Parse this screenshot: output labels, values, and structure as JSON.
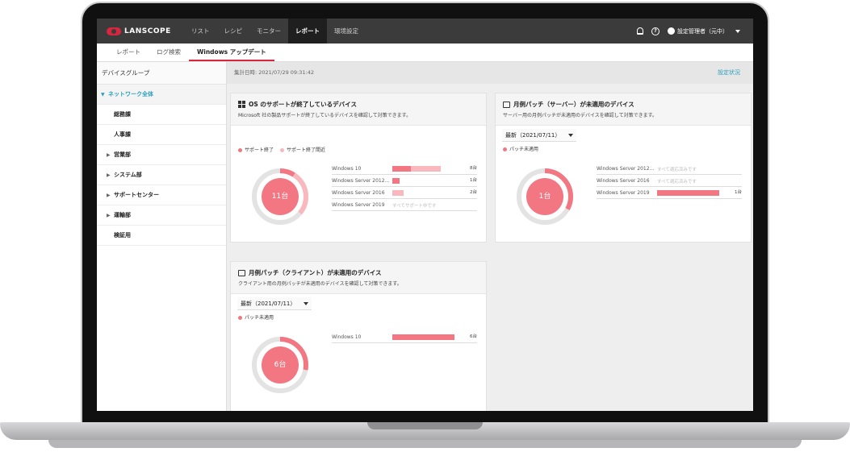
{
  "topbar": {
    "logo": "LANSCOPE",
    "nav": [
      "リスト",
      "レシピ",
      "モニター",
      "レポート",
      "環境設定"
    ],
    "active_nav": "レポート",
    "user_name": "設定管理者（元中）"
  },
  "subnav": {
    "tabs": [
      "レポート",
      "ログ検索",
      "Windows アップデート"
    ],
    "active_tab": "Windows アップデート"
  },
  "sidebar": {
    "header": "デバイスグループ",
    "root": "ネットワーク全体",
    "items": [
      {
        "label": "総務課",
        "expandable": false
      },
      {
        "label": "人事課",
        "expandable": false
      },
      {
        "label": "営業部",
        "expandable": true
      },
      {
        "label": "システム部",
        "expandable": true
      },
      {
        "label": "サポートセンター",
        "expandable": true
      },
      {
        "label": "運輸部",
        "expandable": true
      },
      {
        "label": "検証用",
        "expandable": false
      }
    ]
  },
  "main": {
    "date": "集計日時: 2021/07/29 09:31:42",
    "settings_link": "設定状況"
  },
  "colors": {
    "primary": "#f27783",
    "light": "#f8b8be",
    "ring": "#e3e3e3",
    "accent": "#2b9fbd",
    "brand": "#d7263d"
  },
  "cards": {
    "os": {
      "title": "OS のサポートが終了しているデバイス",
      "desc": "Microsoft 社の製品サポートが終了しているデバイスを確認して対策できます。",
      "legend": [
        "サポート終了",
        "サポート終了間近"
      ],
      "total": "11台",
      "donut": {
        "primary": 0.09,
        "light": 0.27
      },
      "rows": [
        {
          "label": "Windows 10",
          "primary": 8,
          "light": 13,
          "value": "8台",
          "note": ""
        },
        {
          "label": "Windows Server 2012...",
          "primary": 3,
          "light": 0,
          "value": "1台",
          "note": ""
        },
        {
          "label": "Windows Server 2016",
          "primary": 0,
          "light": 5,
          "value": "2台",
          "note": ""
        },
        {
          "label": "Windows Server 2019",
          "primary": 0,
          "light": 0,
          "value": "",
          "note": "すべてサポート中です"
        }
      ]
    },
    "server": {
      "title": "月例パッチ（サーバー）が未適用のデバイス",
      "desc": "サーバー用の月例パッチが未適用のデバイスを確認して対策できます。",
      "dropdown": "最新（2021/07/11）",
      "legend": [
        "パッチ未適用"
      ],
      "total": "1台",
      "donut": {
        "primary": 0.33,
        "light": 0
      },
      "rows": [
        {
          "label": "Windows Server 2012...",
          "primary": 0,
          "light": 0,
          "value": "",
          "note": "すべて適応済みです"
        },
        {
          "label": "Windows Server 2016",
          "primary": 0,
          "light": 0,
          "value": "",
          "note": "すべて適応済みです"
        },
        {
          "label": "Windows Server 2019",
          "primary": 100,
          "light": 0,
          "value": "1台",
          "note": ""
        }
      ]
    },
    "client": {
      "title": "月例パッチ（クライアント）が未適用のデバイス",
      "desc": "クライアント用の月例パッチが未適用のデバイスを確認して対策できます。",
      "dropdown": "最新（2021/07/11）",
      "legend": [
        "パッチ未適用"
      ],
      "total": "6台",
      "donut": {
        "primary": 0.28,
        "light": 0
      },
      "rows": [
        {
          "label": "Windows 10",
          "primary": 100,
          "light": 0,
          "value": "6台",
          "note": ""
        }
      ]
    }
  }
}
